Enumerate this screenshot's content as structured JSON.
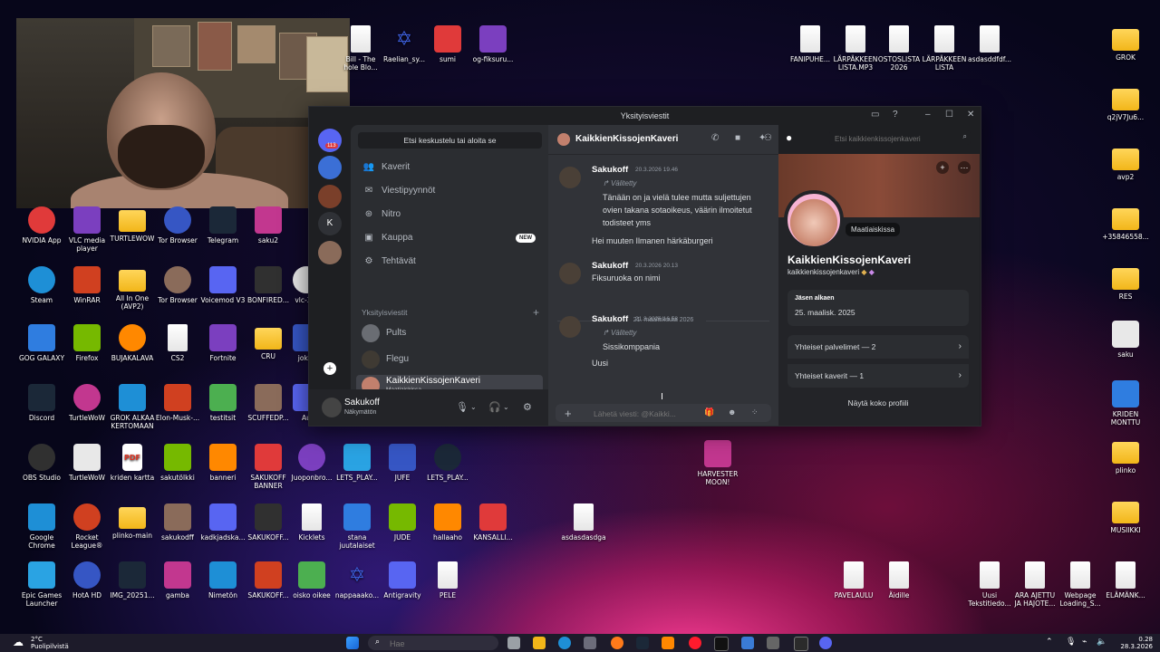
{
  "window": {
    "title": "Yksityisviestit",
    "search_placeholder": "Etsi keskustelu tai aloita se",
    "nav": [
      {
        "label": "Kaverit",
        "icon": "friends-icon"
      },
      {
        "label": "Viestipyynnöt",
        "icon": "mail-icon"
      },
      {
        "label": "Nitro",
        "icon": "nitro-icon"
      },
      {
        "label": "Kauppa",
        "icon": "shop-icon",
        "badge": "NEW"
      },
      {
        "label": "Tehtävät",
        "icon": "quests-icon"
      }
    ],
    "dm_section_label": "Yksityisviestit",
    "dms": [
      {
        "name": "Pults"
      },
      {
        "name": "Flegu"
      },
      {
        "name": "KaikkienKissojenKaveri",
        "sub": "Maatiaiskissa",
        "active": true
      }
    ],
    "server_badge": "113",
    "user": {
      "name": "Sakukoff",
      "status": "Näkymätön"
    }
  },
  "chat": {
    "channel_name": "KaikkienKissojenKaveri",
    "header_search_placeholder": "Etsi kaikkienkissojenkaveri",
    "messages": [
      {
        "author": "Sakukoff",
        "time": "20.3.2026 19.46",
        "forwarded_label": "Välitetty",
        "forwarded_text": "Tänään on ja vielä tulee mutta suljettujen ovien takana sotaoikeus, väärin ilmoitetut todisteet yms",
        "text": "Hei muuten Ilmanen härkäburgeri"
      },
      {
        "author": "Sakukoff",
        "time": "20.3.2026 20.13",
        "text": "Fiksuruoka on nimi"
      },
      {
        "author": "Sakukoff",
        "time": "21.3.2026 16.58",
        "forwarded_label": "Välitetty",
        "forwarded_text": "Sissikomppania",
        "text": "Uusi"
      }
    ],
    "date_divider": "21. maaliskuuta 2026",
    "composer_placeholder": "Lähetä viesti: @Kaikki..."
  },
  "profile": {
    "display_name": "KaikkienKissojenKaveri",
    "username": "kaikkienkissojenkaveri",
    "status": "Maatiaiskissa",
    "member_since_label": "Jäsen alkaen",
    "member_since": "25. maalisk. 2025",
    "mutual_servers": "Yhteiset palvelimet — 2",
    "mutual_friends": "Yhteiset kaverit — 1",
    "full_profile": "Näytä koko profiili"
  },
  "desktop_icons": [
    {
      "label": "Bill - The\nhole Blo...",
      "kind": "file"
    },
    {
      "label": "Raelian_sy...",
      "kind": "star"
    },
    {
      "label": "sumi",
      "kind": "img"
    },
    {
      "label": "og-fiksuru...",
      "kind": "img"
    },
    {
      "label": "FANIPUHE...",
      "kind": "file"
    },
    {
      "label": "LÄRPÄKKEEN\nLISTA.MP3",
      "kind": "file"
    },
    {
      "label": "OSTOSLISTA\n2026",
      "kind": "file"
    },
    {
      "label": "LÄRPÄKKEEN\nLISTA",
      "kind": "file"
    },
    {
      "label": "asdasddfdf...",
      "kind": "file"
    },
    {
      "label": "GROK",
      "kind": "folder"
    },
    {
      "label": "q2jV7Ju6...",
      "kind": "folder"
    },
    {
      "label": "avp2",
      "kind": "folder"
    },
    {
      "label": "+35846558...",
      "kind": "folder"
    },
    {
      "label": "RES",
      "kind": "folder"
    },
    {
      "label": "saku",
      "kind": "img"
    },
    {
      "label": "KRIDEN\nMONTTU",
      "kind": "img"
    },
    {
      "label": "plinko",
      "kind": "folder"
    },
    {
      "label": "MUSIIKKI",
      "kind": "folder"
    },
    {
      "label": "NVIDIA App",
      "kind": "app"
    },
    {
      "label": "VLC media\nplayer",
      "kind": "app"
    },
    {
      "label": "TURTLEWOW",
      "kind": "folder"
    },
    {
      "label": "Tor Browser",
      "kind": "app"
    },
    {
      "label": "Telegram",
      "kind": "app"
    },
    {
      "label": "saku2",
      "kind": "app"
    },
    {
      "label": "Steam",
      "kind": "app"
    },
    {
      "label": "WinRAR",
      "kind": "app"
    },
    {
      "label": "All In One\n(AVP2)",
      "kind": "folder"
    },
    {
      "label": "Tor Browser",
      "kind": "app"
    },
    {
      "label": "Voicemod V3",
      "kind": "app"
    },
    {
      "label": "BONFIRED...",
      "kind": "app"
    },
    {
      "label": "vlc-3...",
      "kind": "app"
    },
    {
      "label": "GOG GALAXY",
      "kind": "app"
    },
    {
      "label": "Firefox",
      "kind": "app"
    },
    {
      "label": "BUJAKALAVA",
      "kind": "app"
    },
    {
      "label": "CS2",
      "kind": "file"
    },
    {
      "label": "Fortnite",
      "kind": "app"
    },
    {
      "label": "CRU",
      "kind": "folder"
    },
    {
      "label": "joker",
      "kind": "app"
    },
    {
      "label": "Discord",
      "kind": "app"
    },
    {
      "label": "TurtleWoW",
      "kind": "app"
    },
    {
      "label": "GROK ALKAA\nKERTOMAAN",
      "kind": "img"
    },
    {
      "label": "Elon-Musk-...",
      "kind": "img"
    },
    {
      "label": "testitsit",
      "kind": "img"
    },
    {
      "label": "SCUFFEDP...",
      "kind": "app"
    },
    {
      "label": "Au",
      "kind": "app"
    },
    {
      "label": "OBS Studio",
      "kind": "app"
    },
    {
      "label": "TurtleWoW",
      "kind": "app"
    },
    {
      "label": "kriden kartta",
      "kind": "pdf"
    },
    {
      "label": "sakutölkki",
      "kind": "img"
    },
    {
      "label": "banneri",
      "kind": "img"
    },
    {
      "label": "SAKUKOFF\nBANNER",
      "kind": "img"
    },
    {
      "label": "Juoponbro...",
      "kind": "app"
    },
    {
      "label": "LETS_PLAY...",
      "kind": "img"
    },
    {
      "label": "JUFE",
      "kind": "img"
    },
    {
      "label": "LETS_PLAY...",
      "kind": "app"
    },
    {
      "label": "HARVESTER\nMOON!",
      "kind": "img"
    },
    {
      "label": "Google\nChrome",
      "kind": "app"
    },
    {
      "label": "Rocket\nLeague®",
      "kind": "app"
    },
    {
      "label": "plinko-main",
      "kind": "folder"
    },
    {
      "label": "sakukodff",
      "kind": "img"
    },
    {
      "label": "kadkjadska...",
      "kind": "img"
    },
    {
      "label": "SAKUKOFF...",
      "kind": "img"
    },
    {
      "label": "Kicklets",
      "kind": "file"
    },
    {
      "label": "stana\njuutalaiset",
      "kind": "img"
    },
    {
      "label": "JUDE",
      "kind": "img"
    },
    {
      "label": "hallaaho",
      "kind": "img"
    },
    {
      "label": "KANSALLI...",
      "kind": "img"
    },
    {
      "label": "asdasdasdga",
      "kind": "file"
    },
    {
      "label": "Epic Games\nLauncher",
      "kind": "app"
    },
    {
      "label": "HotA HD",
      "kind": "app"
    },
    {
      "label": "IMG_20251...",
      "kind": "img"
    },
    {
      "label": "gamba",
      "kind": "img"
    },
    {
      "label": "Nimetön",
      "kind": "img"
    },
    {
      "label": "SAKUKOFF...",
      "kind": "img"
    },
    {
      "label": "oisko oikee",
      "kind": "img"
    },
    {
      "label": "nappaaako...",
      "kind": "star"
    },
    {
      "label": "Antigravity",
      "kind": "app"
    },
    {
      "label": "PELE",
      "kind": "file"
    },
    {
      "label": "PAVELAULU",
      "kind": "file"
    },
    {
      "label": "Äidille",
      "kind": "file"
    },
    {
      "label": "Uusi\nTekstitiedo...",
      "kind": "file"
    },
    {
      "label": "ARA AJETTU\nJA HAJOTE...",
      "kind": "file"
    },
    {
      "label": "Webpage\nLoading_S...",
      "kind": "file"
    },
    {
      "label": "ELÄMÄNK...",
      "kind": "file"
    }
  ],
  "taskbar": {
    "weather_temp": "2°C",
    "weather_text": "Puolipilvistä",
    "search_placeholder": "Hae",
    "time": "0.28",
    "date": "28.3.2026"
  }
}
